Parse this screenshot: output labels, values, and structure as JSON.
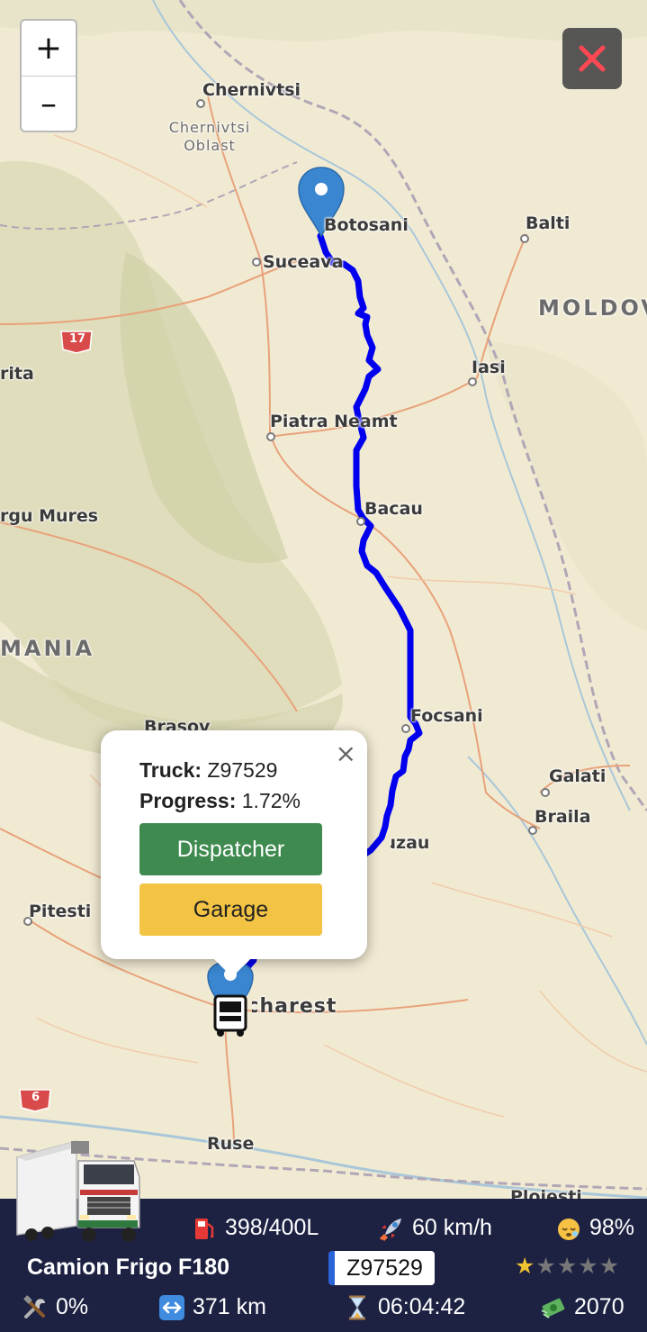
{
  "map": {
    "cities": [
      {
        "name": "Chernivtsi"
      },
      {
        "name": "Botosani"
      },
      {
        "name": "Balti"
      },
      {
        "name": "Suceava"
      },
      {
        "name": "Iasi"
      },
      {
        "name": "Piatra Neamt"
      },
      {
        "name": "Bacau"
      },
      {
        "name": "rgu Mures"
      },
      {
        "name": "Brasov"
      },
      {
        "name": "Focsani"
      },
      {
        "name": "Galati"
      },
      {
        "name": "Braila"
      },
      {
        "name": "Buzau"
      },
      {
        "name": "Pitesti"
      },
      {
        "name": "Bucharest"
      },
      {
        "name": "Ruse"
      },
      {
        "name": "rita"
      },
      {
        "name": "Ploiesti"
      }
    ],
    "region": "Chernivtsi Oblast",
    "countries": [
      "MOLDOVA",
      "MANIA"
    ],
    "road_shields": [
      "17",
      "6"
    ],
    "route_color": "#0000ee"
  },
  "controls": {
    "zoom_in": "+",
    "zoom_out": "–",
    "close_icon": "close-icon"
  },
  "popup": {
    "truck_label": "Truck:",
    "truck_value": "Z97529",
    "progress_label": "Progress:",
    "progress_value": "1.72%",
    "progress_fraction": 0.0172,
    "close": "×",
    "dispatcher_button": "Dispatcher",
    "garage_button": "Garage"
  },
  "status_bar": {
    "fuel": "398/400L",
    "speed": "60 km/h",
    "rest": "98%",
    "truck_name": "Camion Frigo F180",
    "plate": "Z97529",
    "rating": 1,
    "rating_max": 5,
    "wear": "0%",
    "distance": "371 km",
    "time": "06:04:42",
    "money": "2070",
    "colors": {
      "background": "#1d2243",
      "plate_accent": "#2b63d9",
      "star": "#f1c232"
    }
  }
}
